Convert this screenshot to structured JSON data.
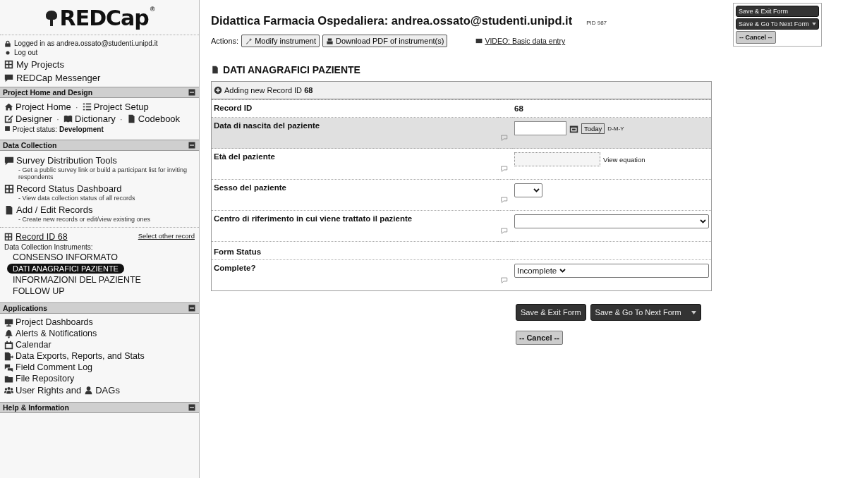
{
  "sidebar": {
    "logo": "REDCap",
    "logo_mark": "®",
    "logged_in": "Logged in as andrea.ossato@studenti.unipd.it",
    "logout": "Log out",
    "top_links": [
      "My Projects",
      "REDCap Messenger"
    ],
    "sections": [
      {
        "title": "Project Home and Design",
        "rows": [
          {
            "kind": "links",
            "separator": "·",
            "links": [
              "Project Home",
              "Project Setup"
            ]
          },
          {
            "kind": "links",
            "separator": "·",
            "links": [
              "Designer",
              "Dictionary",
              "Codebook"
            ]
          },
          {
            "kind": "status",
            "label": "Project status:",
            "value": "Development"
          }
        ]
      },
      {
        "title": "Data Collection",
        "rows": [
          {
            "kind": "tool",
            "label": "Survey Distribution Tools",
            "description": "- Get a public survey link or build a participant list for inviting respondents"
          },
          {
            "kind": "tool",
            "label": "Record Status Dashboard",
            "description": "- View data collection status of all records"
          },
          {
            "kind": "tool",
            "label": "Add / Edit Records",
            "description": "- Create new records or edit/view existing ones"
          },
          {
            "kind": "record",
            "label": "Record ID 68",
            "link": "Select other record"
          },
          {
            "kind": "caption",
            "label": "Data Collection Instruments:"
          },
          {
            "kind": "instrument",
            "label": "CONSENSO INFORMATO",
            "selected": false
          },
          {
            "kind": "instrument",
            "label": "DATI ANAGRAFICI PAZIENTE",
            "selected": true
          },
          {
            "kind": "instrument",
            "label": "INFORMAZIONI DEL PAZIENTE",
            "selected": false
          },
          {
            "kind": "instrument",
            "label": "FOLLOW UP",
            "selected": false
          }
        ]
      },
      {
        "title": "Applications",
        "rows": [
          {
            "kind": "app",
            "label": "Project Dashboards"
          },
          {
            "kind": "app",
            "label": "Alerts & Notifications"
          },
          {
            "kind": "app",
            "label": "Calendar"
          },
          {
            "kind": "app",
            "label": "Data Exports, Reports, and Stats"
          },
          {
            "kind": "app",
            "label": "Field Comment Log"
          },
          {
            "kind": "app",
            "label": "File Repository"
          },
          {
            "kind": "links",
            "links": [
              "User Rights and",
              "DAGs"
            ]
          }
        ]
      },
      {
        "title": "Help & Information"
      }
    ]
  },
  "main": {
    "title": "Didattica Farmacia Ospedaliera: andrea.ossato@studenti.unipd.it",
    "pid": "PID 987",
    "actions_label": "Actions:",
    "actions": [
      "Modify instrument",
      "Download PDF of instrument(s)"
    ],
    "video_link": "VIDEO: Basic data entry",
    "form_title": "DATI ANAGRAFICI PAZIENTE",
    "form_header": "Adding new Record ID **68**",
    "rows": [
      {
        "kind": "text",
        "label": "Record ID",
        "value": "68",
        "highlighted": false
      },
      {
        "kind": "date",
        "label": "Data di nascita del paziente",
        "button": "Today",
        "format": "D-M-Y",
        "highlighted": true
      },
      {
        "kind": "calc",
        "label": "Età del paziente",
        "link": "View equation",
        "highlighted": false
      },
      {
        "kind": "select_small",
        "label": "Sesso del paziente",
        "highlighted": false
      },
      {
        "kind": "select_wide",
        "label": "Centro di riferimento in cui viene trattato il paziente",
        "highlighted": false
      },
      {
        "kind": "section",
        "label": "Form Status"
      },
      {
        "kind": "select_value",
        "label": "Complete?",
        "value": "Incomplete",
        "highlighted": false
      }
    ],
    "buttons": [
      "Save & Exit Form",
      "Save & Go To Next Form"
    ],
    "cancel": "-- Cancel --"
  },
  "floating": {
    "buttons": [
      "Save & Exit Form",
      "Save & Go To Next Form"
    ],
    "cancel": "-- Cancel --"
  }
}
